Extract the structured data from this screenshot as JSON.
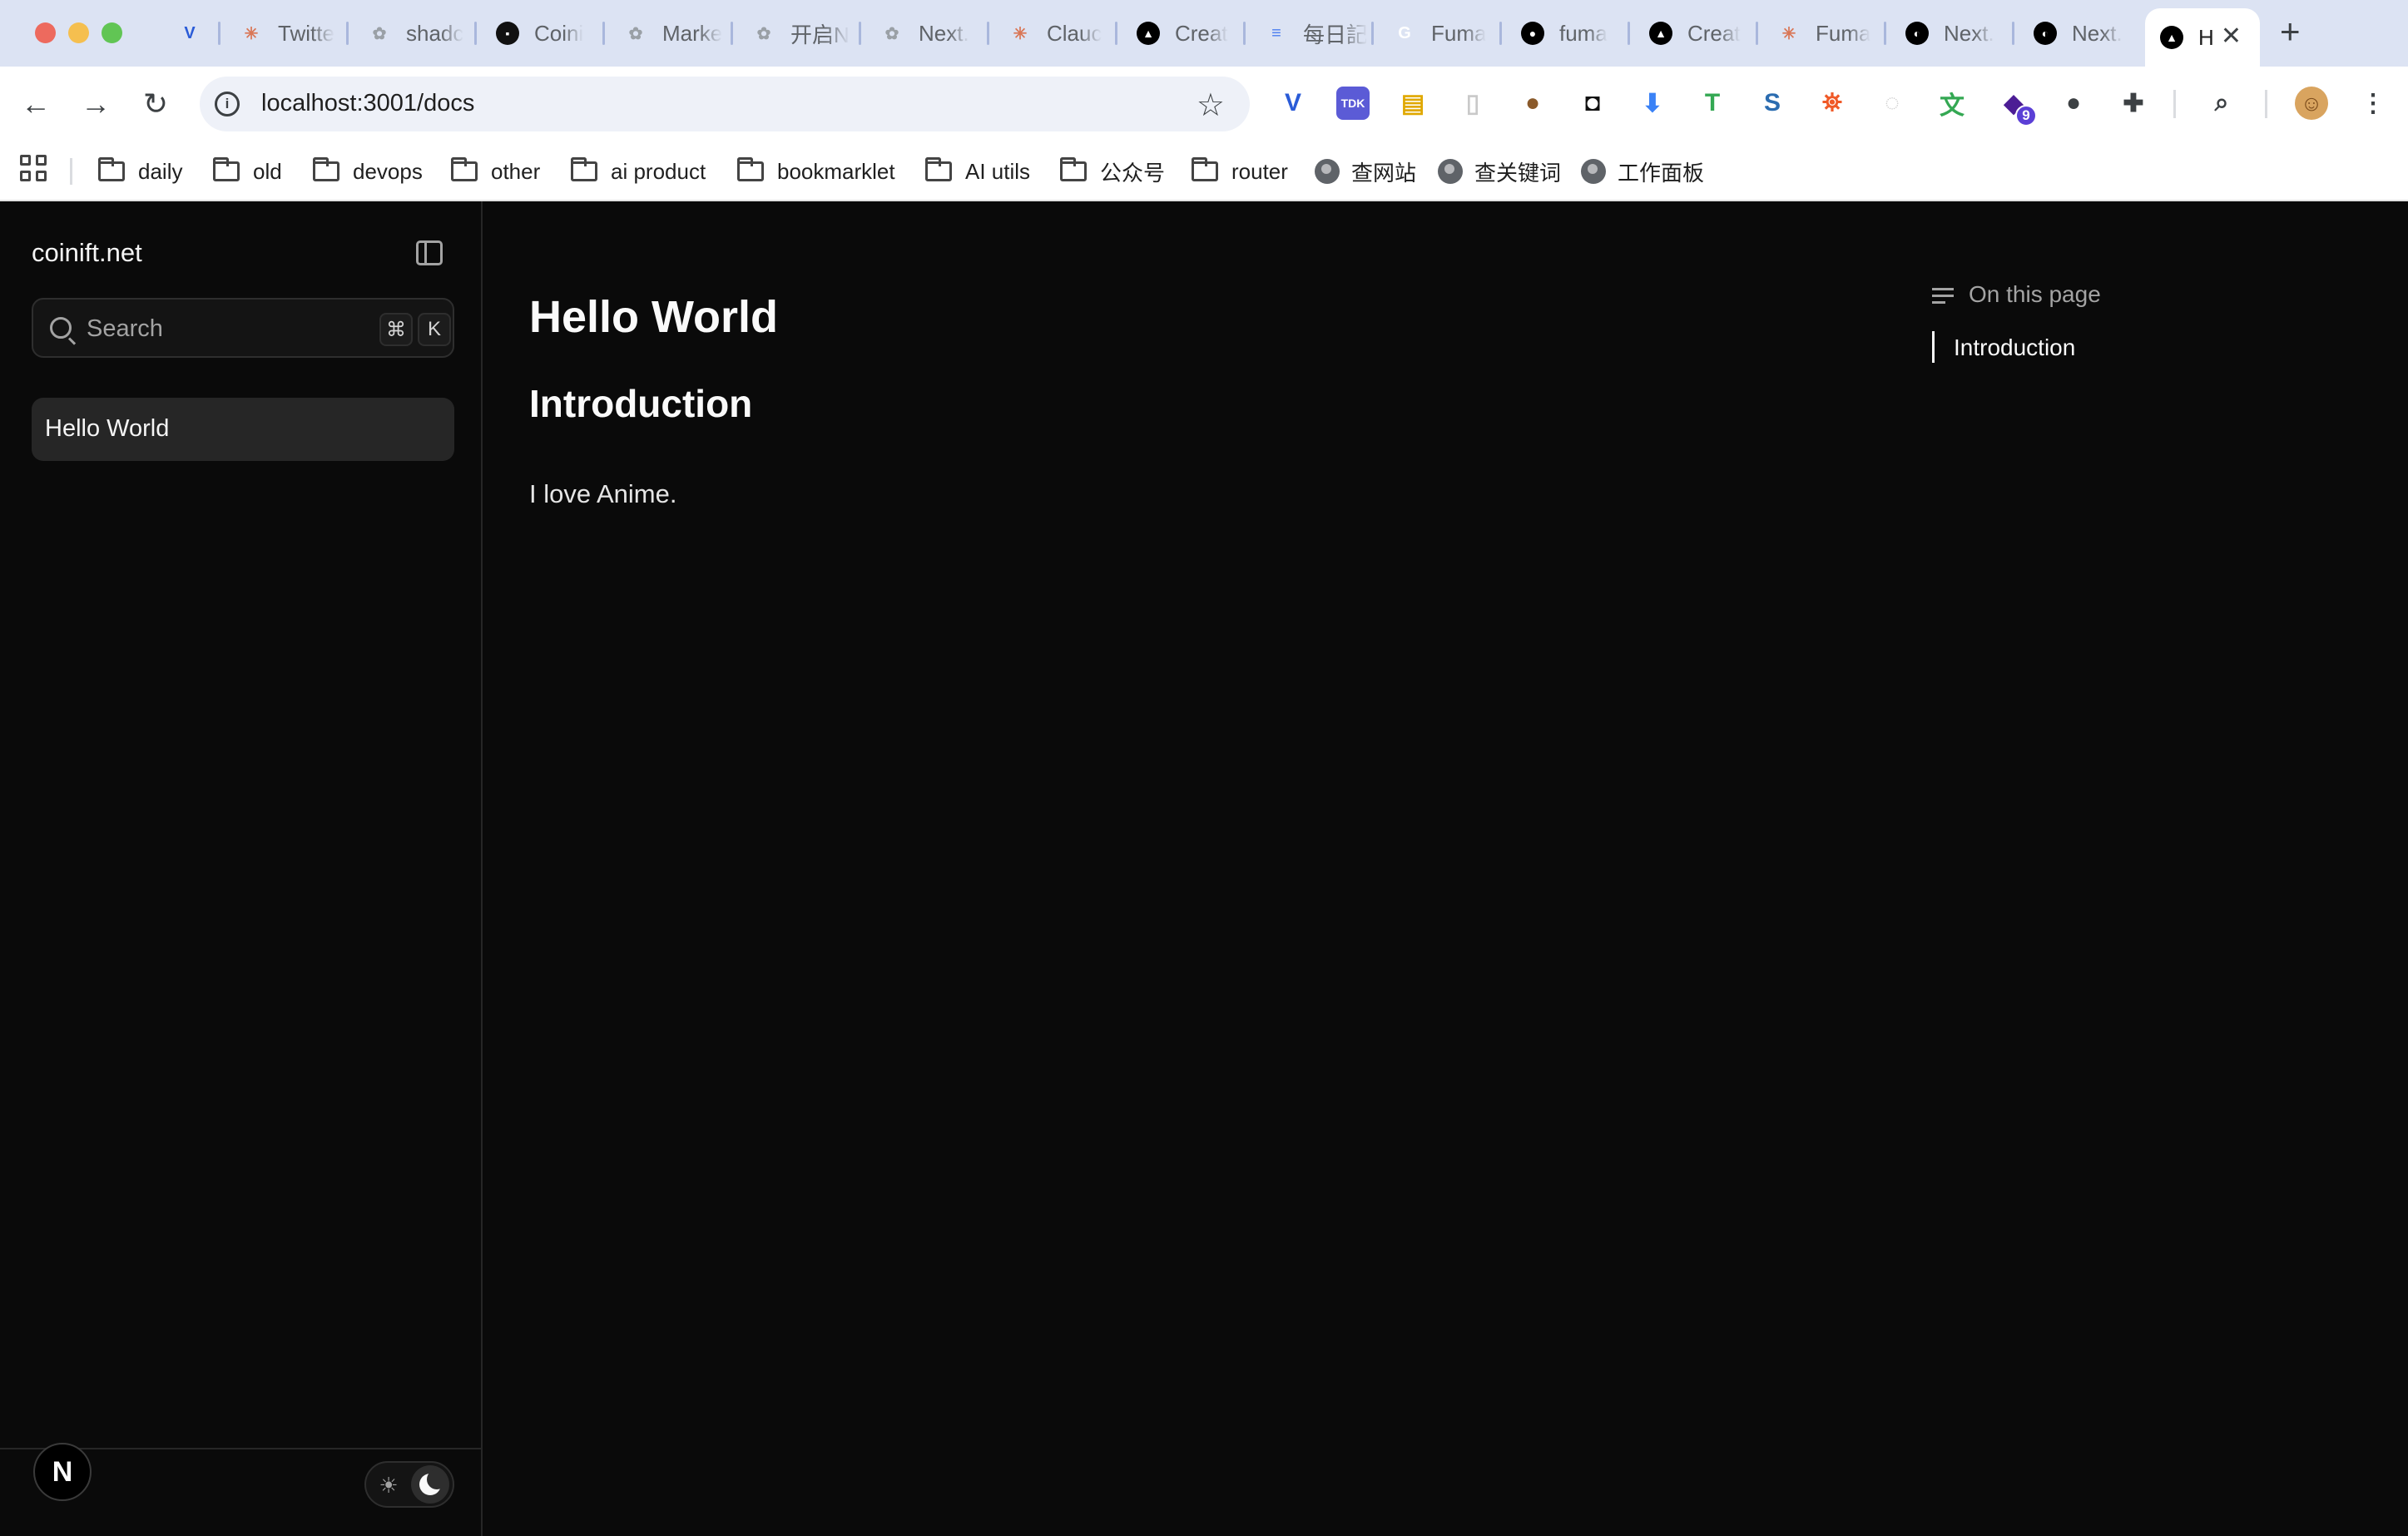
{
  "browser": {
    "tabs": [
      {
        "title": "",
        "icon": "vercel-v-icon",
        "color": "#2a5bd7"
      },
      {
        "title": "Twitte",
        "icon": "asterisk-icon",
        "color": "#d97757"
      },
      {
        "title": "shadc",
        "icon": "openai-icon",
        "color": "#9aa0a6"
      },
      {
        "title": "Coini",
        "icon": "coinift-icon",
        "color": "#111111"
      },
      {
        "title": "Marke",
        "icon": "openai-icon",
        "color": "#9aa0a6"
      },
      {
        "title": "开启N",
        "icon": "openai-icon",
        "color": "#9aa0a6"
      },
      {
        "title": "Next.",
        "icon": "openai-icon",
        "color": "#9aa0a6"
      },
      {
        "title": "Clauc",
        "icon": "asterisk-icon",
        "color": "#d97757"
      },
      {
        "title": "Creat",
        "icon": "triangle-icon",
        "color": "#000000"
      },
      {
        "title": "每日記",
        "icon": "docs-icon",
        "color": "#4a7cf0"
      },
      {
        "title": "Fuma",
        "icon": "google-icon",
        "color": "#ffffff"
      },
      {
        "title": "fuma",
        "icon": "github-icon",
        "color": "#000000"
      },
      {
        "title": "Creat",
        "icon": "triangle-icon",
        "color": "#000000"
      },
      {
        "title": "Fuma",
        "icon": "asterisk-icon",
        "color": "#d97757"
      },
      {
        "title": "Next.",
        "icon": "nextjs-icon",
        "color": "#000000"
      },
      {
        "title": "Next.",
        "icon": "nextjs-icon",
        "color": "#000000"
      }
    ],
    "active_tab": {
      "title": "H",
      "icon": "triangle-icon",
      "close_glyph": "✕"
    },
    "new_tab_glyph": "+",
    "url": "localhost:3001/docs",
    "extensions": [
      {
        "icon": "vercel-v-icon",
        "label": "",
        "color": "#2a5bd7"
      },
      {
        "icon": "tdk-icon",
        "label": "TDK",
        "color": "#5b5bd6"
      },
      {
        "icon": "chart-folder-icon",
        "label": "",
        "color": "#e0a800"
      },
      {
        "icon": "document-icon",
        "label": "",
        "color": "#c9c9c9"
      },
      {
        "icon": "cookie-icon",
        "label": "",
        "color": "#8a5a2b"
      },
      {
        "icon": "glasses-icon",
        "label": "",
        "color": "#111111"
      },
      {
        "icon": "file-download-icon",
        "label": "",
        "color": "#3b82f6"
      },
      {
        "icon": "color-t-icon",
        "label": "",
        "color": "#34a853"
      },
      {
        "icon": "s-logo-icon",
        "label": "",
        "color": "#2b6cb0"
      },
      {
        "icon": "lighthouse-icon",
        "label": "",
        "color": "#f05a28"
      },
      {
        "icon": "bubble-icon",
        "label": "",
        "color": "#d0d0d0"
      },
      {
        "icon": "translate-icon",
        "label": "",
        "color": "#34a853"
      },
      {
        "icon": "graduation-cap-icon",
        "label": "",
        "badge": "9",
        "color": "#4c1d95"
      },
      {
        "icon": "circle-dark-icon",
        "label": "",
        "color": "#3c4043"
      },
      {
        "icon": "puzzle-icon",
        "label": "",
        "color": "#3c4043"
      },
      {
        "icon": "tab-search-icon",
        "label": "",
        "color": "#3c4043"
      },
      {
        "icon": "profile-avatar-icon",
        "label": "",
        "color": "#d9a45f"
      },
      {
        "icon": "kebab-menu-icon",
        "label": "",
        "color": "#3c4043"
      }
    ],
    "bookmarks": [
      {
        "label": "daily",
        "type": "folder"
      },
      {
        "label": "old",
        "type": "folder"
      },
      {
        "label": "devops",
        "type": "folder"
      },
      {
        "label": "other",
        "type": "folder"
      },
      {
        "label": "ai product",
        "type": "folder"
      },
      {
        "label": "bookmarklet",
        "type": "folder"
      },
      {
        "label": "AI utils",
        "type": "folder"
      },
      {
        "label": "公众号",
        "type": "folder"
      },
      {
        "label": "router",
        "type": "folder"
      },
      {
        "label": "查网站",
        "type": "globe"
      },
      {
        "label": "查关键词",
        "type": "globe"
      },
      {
        "label": "工作面板",
        "type": "globe"
      }
    ]
  },
  "sidebar": {
    "site_title": "coinift.net",
    "search": {
      "placeholder": "Search",
      "shortcut_mod": "⌘",
      "shortcut_key": "K"
    },
    "items": [
      {
        "label": "Hello World",
        "active": true
      }
    ],
    "footer": {
      "logo_text": "N",
      "theme_sun_glyph": "☀"
    }
  },
  "main": {
    "title": "Hello World",
    "heading": "Introduction",
    "paragraph": "I love Anime."
  },
  "toc": {
    "title": "On this page",
    "items": [
      {
        "label": "Introduction",
        "active": true
      }
    ]
  },
  "colors": {
    "page_bg": "#0a0a0a",
    "chrome_tabbar": "#dce3f3",
    "accent_active_item": "#262626"
  }
}
